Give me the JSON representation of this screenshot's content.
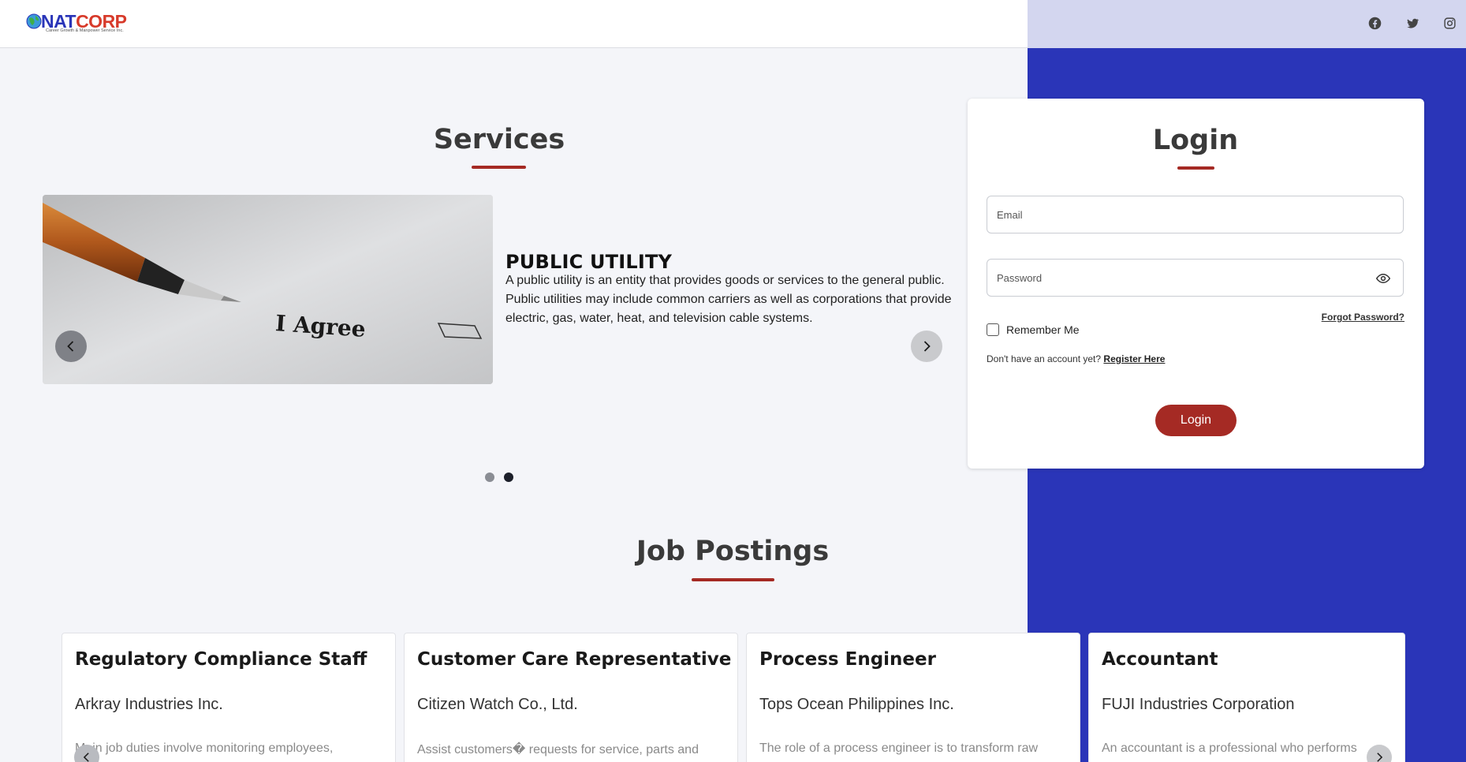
{
  "brand": {
    "name_part1": "NAT",
    "name_part2": "CORP",
    "tagline": "Career Growth & Manpower Service Inc.",
    "primary_color": "#2a35b8",
    "accent_color": "#a52a24"
  },
  "social": {
    "icons": [
      "facebook-icon",
      "twitter-icon",
      "instagram-icon"
    ]
  },
  "services": {
    "title": "Services",
    "slide": {
      "image_text": "I Agree",
      "title": "PUBLIC UTILITY",
      "description": "A public utility is an entity that provides goods or services to the general public. Public utilities may include common carriers as well as corporations that provide electric, gas, water, heat, and television cable systems."
    },
    "slide_count": 2,
    "active_slide": 2
  },
  "login": {
    "title": "Login",
    "email_placeholder": "Email",
    "password_placeholder": "Password",
    "forgot_password": "Forgot Password?",
    "remember_me": "Remember Me",
    "no_account": "Don't have an account yet?",
    "register_link": "Register Here",
    "button": "Login"
  },
  "jobs": {
    "title": "Job Postings",
    "items": [
      {
        "title": "Regulatory Compliance Staff",
        "company": "Arkray Industries Inc.",
        "description": "Main job duties involve monitoring employees,"
      },
      {
        "title": "Customer Care Representative",
        "company": "Citizen Watch Co., Ltd.",
        "description": "Assist customers� requests for service, parts and"
      },
      {
        "title": "Process Engineer",
        "company": "Tops Ocean Philippines Inc.",
        "description": "The role of a process engineer is to transform raw"
      },
      {
        "title": "Accountant",
        "company": "FUJI Industries Corporation",
        "description": "An accountant is a professional who performs"
      }
    ]
  }
}
